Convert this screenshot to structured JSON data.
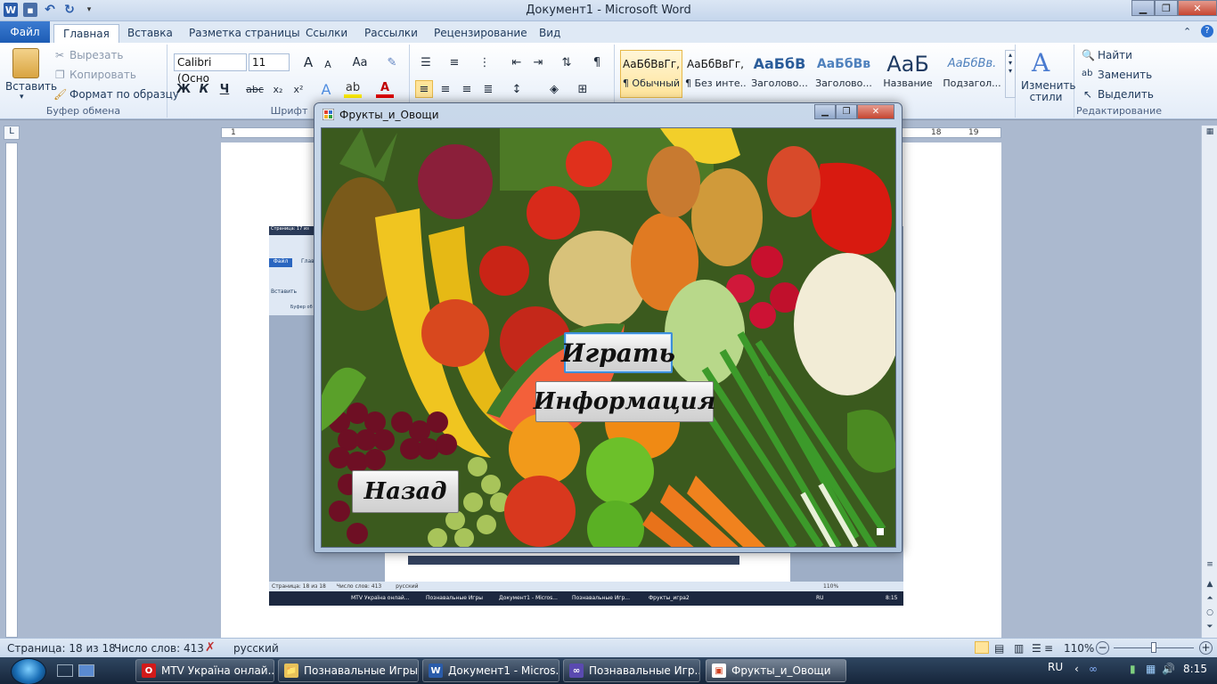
{
  "word": {
    "title": "Документ1 - Microsoft Word",
    "app_icon": "W",
    "tabs": [
      "Файл",
      "Главная",
      "Вставка",
      "Разметка страницы",
      "Ссылки",
      "Рассылки",
      "Рецензирование",
      "Вид"
    ],
    "clipboard": {
      "paste": "Вставить",
      "cut": "Вырезать",
      "copy": "Копировать",
      "format_painter": "Формат по образцу",
      "label": "Буфер обмена"
    },
    "font": {
      "name": "Calibri (Осно",
      "size": "11",
      "label": "Шрифт",
      "bold": "Ж",
      "italic": "К",
      "underline": "Ч",
      "strike": "abc",
      "sub": "x₂",
      "sup": "x²",
      "grow": "A",
      "shrink": "A",
      "case": "Aa",
      "color_a": "A"
    },
    "styles": [
      {
        "sample": "АаБбВвГг,",
        "name": "¶ Обычный"
      },
      {
        "sample": "АаБбВвГг,",
        "name": "¶ Без инте..."
      },
      {
        "sample": "АаБбВ",
        "name": "Заголово..."
      },
      {
        "sample": "АаБбВв",
        "name": "Заголово..."
      },
      {
        "sample": "АаБ",
        "name": "Название"
      },
      {
        "sample": "АаБбВв.",
        "name": "Подзагол..."
      }
    ],
    "change_styles": "Изменить стили",
    "editing": {
      "find": "Найти",
      "replace": "Заменить",
      "select": "Выделить",
      "label": "Редактирование"
    },
    "ruler": {
      "left": "1",
      "n18": "18",
      "n19": "19"
    },
    "status": {
      "page": "Страница: 18 из 18",
      "words": "Число слов: 413",
      "language": "русский",
      "zoom": "110%"
    }
  },
  "fruits_window": {
    "title": "Фрукты_и_Овощи",
    "buttons": {
      "play": "Играть",
      "info": "Информация",
      "back": "Назад"
    }
  },
  "pasted_screenshot": {
    "file_tab": "Файл",
    "main_tab": "Глав",
    "paste": "Вставить",
    "clip_label": "Буфер об",
    "status_page": "Страница: 18 из 18",
    "status_words": "Число слов: 413",
    "status_lang": "русский",
    "status_zoom": "110%",
    "top_status": "Страница: 17 из",
    "tasks": [
      "MTV Україна онлай...",
      "Познавальные Игры",
      "Документ1 - Micros...",
      "Познавальные Игр...",
      "Фрукты_игра2"
    ],
    "tray_lang": "RU",
    "tray_time": "8:15"
  },
  "taskbar": {
    "items": [
      {
        "label": "MTV Україна онлай...",
        "icon": "O"
      },
      {
        "label": "Познавальные Игры",
        "icon": "📁"
      },
      {
        "label": "Документ1 - Micros...",
        "icon": "W"
      },
      {
        "label": "Познавальные Игр...",
        "icon": "∞"
      },
      {
        "label": "Фрукты_и_Овощи",
        "icon": "▣"
      }
    ],
    "lang": "RU",
    "time": "8:15"
  },
  "colors": {
    "ribbon_blue": "#1d5cb4",
    "focus_border": "#3d8ed8",
    "taskbar": "#1c2c44"
  }
}
